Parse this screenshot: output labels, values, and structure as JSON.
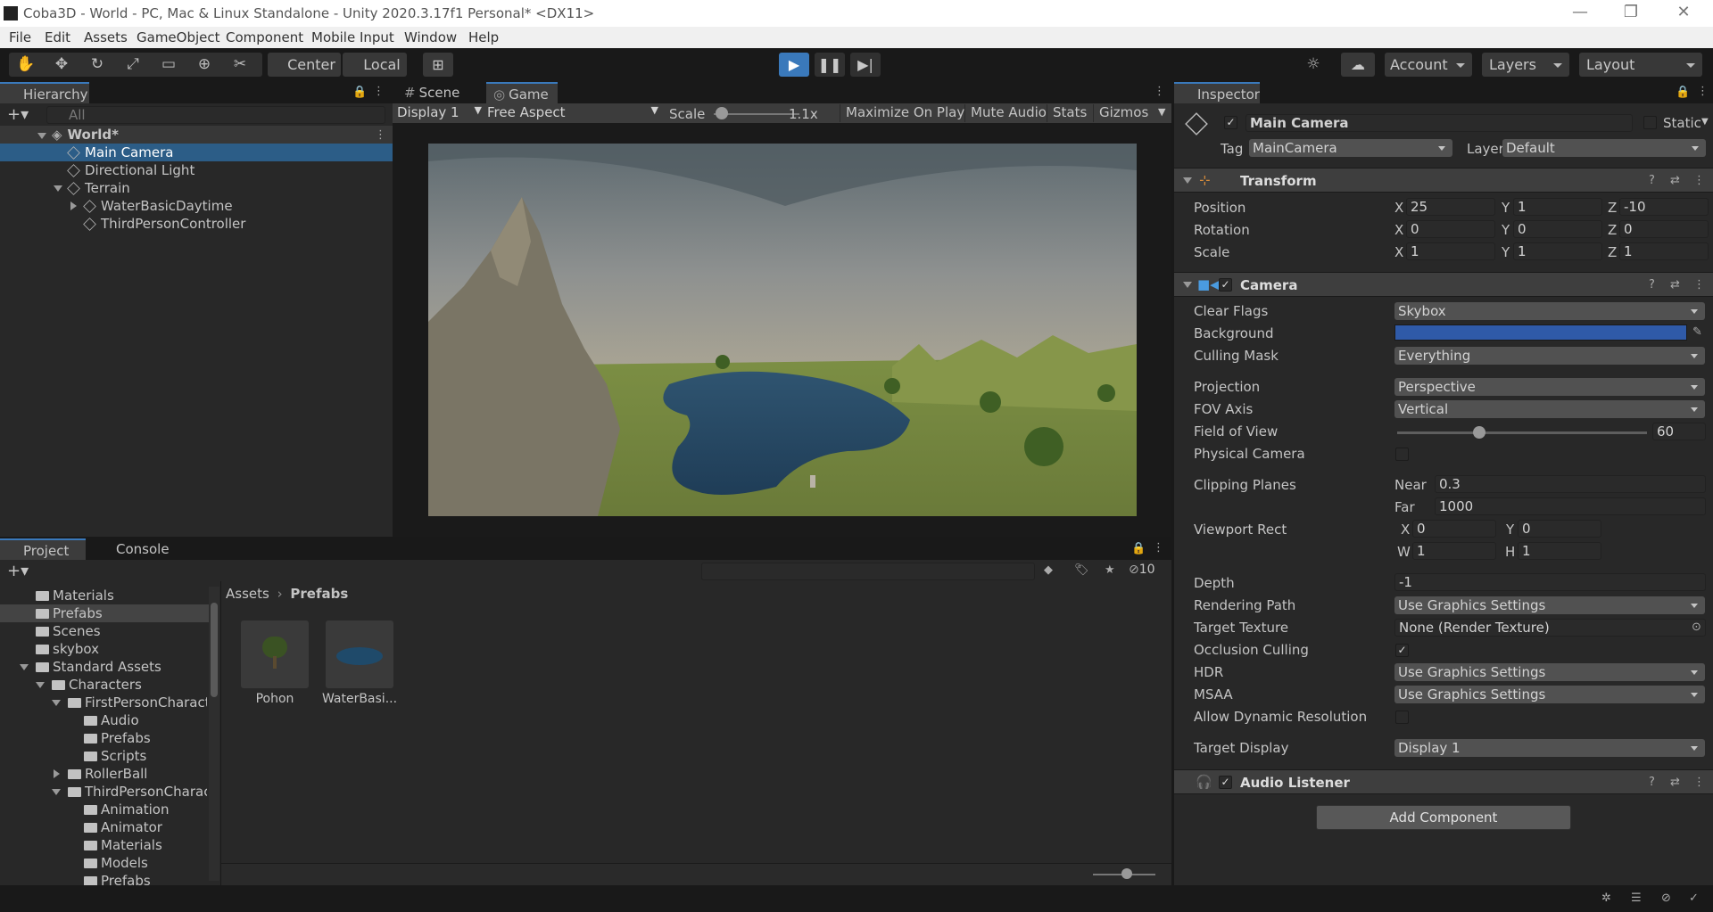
{
  "window": {
    "title": "Coba3D - World - PC, Mac & Linux Standalone - Unity 2020.3.17f1 Personal* <DX11>",
    "minimize": "—",
    "restore": "❐",
    "close": "✕"
  },
  "menu": [
    "File",
    "Edit",
    "Assets",
    "GameObject",
    "Component",
    "Mobile Input",
    "Window",
    "Help"
  ],
  "toolbar": {
    "tools": [
      "hand-tool-icon",
      "move-tool-icon",
      "rotate-tool-icon",
      "scale-tool-icon",
      "rect-tool-icon",
      "transform-tool-icon",
      "custom-tool-icon"
    ],
    "pivot_label": "Center",
    "space_label": "Local",
    "account_label": "Account",
    "layers_label": "Layers",
    "layout_label": "Layout",
    "play_accent": "#3a79bb"
  },
  "hierarchy": {
    "tab": "Hierarchy",
    "search_placeholder": "All",
    "scene": "World*",
    "items": [
      {
        "label": "Main Camera",
        "selected": true
      },
      {
        "label": "Directional Light"
      },
      {
        "label": "Terrain"
      },
      {
        "label": "WaterBasicDaytime"
      },
      {
        "label": "ThirdPersonController"
      }
    ]
  },
  "game": {
    "tabs": [
      "Scene",
      "Game"
    ],
    "display": "Display 1",
    "aspect": "Free Aspect",
    "scale_label": "Scale",
    "scale_value": "1.1x",
    "maximize": "Maximize On Play",
    "mute": "Mute Audio",
    "stats": "Stats",
    "gizmos": "Gizmos"
  },
  "project": {
    "tabs": [
      "Project",
      "Console"
    ],
    "hidden_count": "10",
    "breadcrumb": [
      "Assets",
      "Prefabs"
    ],
    "tree": [
      {
        "label": "Materials"
      },
      {
        "label": "Prefabs",
        "selected": true
      },
      {
        "label": "Scenes"
      },
      {
        "label": "skybox"
      },
      {
        "label": "Standard Assets"
      },
      {
        "label": "Characters"
      },
      {
        "label": "FirstPersonCharact"
      },
      {
        "label": "Audio"
      },
      {
        "label": "Prefabs"
      },
      {
        "label": "Scripts"
      },
      {
        "label": "RollerBall"
      },
      {
        "label": "ThirdPersonCharac"
      },
      {
        "label": "Animation"
      },
      {
        "label": "Animator"
      },
      {
        "label": "Materials"
      },
      {
        "label": "Models"
      },
      {
        "label": "Prefabs"
      }
    ],
    "assets": [
      {
        "label": "Pohon"
      },
      {
        "label": "WaterBasi..."
      }
    ]
  },
  "inspector": {
    "tab": "Inspector",
    "object_name": "Main Camera",
    "static_label": "Static",
    "tag_label": "Tag",
    "tag_value": "MainCamera",
    "layer_label": "Layer",
    "layer_value": "Default",
    "transform": {
      "title": "Transform",
      "position_label": "Position",
      "px": "25",
      "py": "1",
      "pz": "-10",
      "rotation_label": "Rotation",
      "rx": "0",
      "ry": "0",
      "rz": "0",
      "scale_label": "Scale",
      "sx": "1",
      "sy": "1",
      "sz": "1",
      "x": "X",
      "y": "Y",
      "z": "Z"
    },
    "camera": {
      "title": "Camera",
      "clear_flags_label": "Clear Flags",
      "clear_flags": "Skybox",
      "background_label": "Background",
      "background_color": "#2f5aa8",
      "culling_label": "Culling Mask",
      "culling": "Everything",
      "projection_label": "Projection",
      "projection": "Perspective",
      "fov_axis_label": "FOV Axis",
      "fov_axis": "Vertical",
      "fov_label": "Field of View",
      "fov": "60",
      "fov_fraction": 0.33,
      "physical_label": "Physical Camera",
      "clipping_label": "Clipping Planes",
      "near_label": "Near",
      "near": "0.3",
      "far_label": "Far",
      "far": "1000",
      "viewport_label": "Viewport Rect",
      "vx_label": "X",
      "vx": "0",
      "vy_label": "Y",
      "vy": "0",
      "vw_label": "W",
      "vw": "1",
      "vh_label": "H",
      "vh": "1",
      "depth_label": "Depth",
      "depth": "-1",
      "rendering_label": "Rendering Path",
      "rendering": "Use Graphics Settings",
      "target_tex_label": "Target Texture",
      "target_tex": "None (Render Texture)",
      "occlusion_label": "Occlusion Culling",
      "hdr_label": "HDR",
      "hdr": "Use Graphics Settings",
      "msaa_label": "MSAA",
      "msaa": "Use Graphics Settings",
      "dynres_label": "Allow Dynamic Resolution",
      "target_display_label": "Target Display",
      "target_display": "Display 1"
    },
    "audio": {
      "title": "Audio Listener"
    },
    "add_component": "Add Component"
  }
}
